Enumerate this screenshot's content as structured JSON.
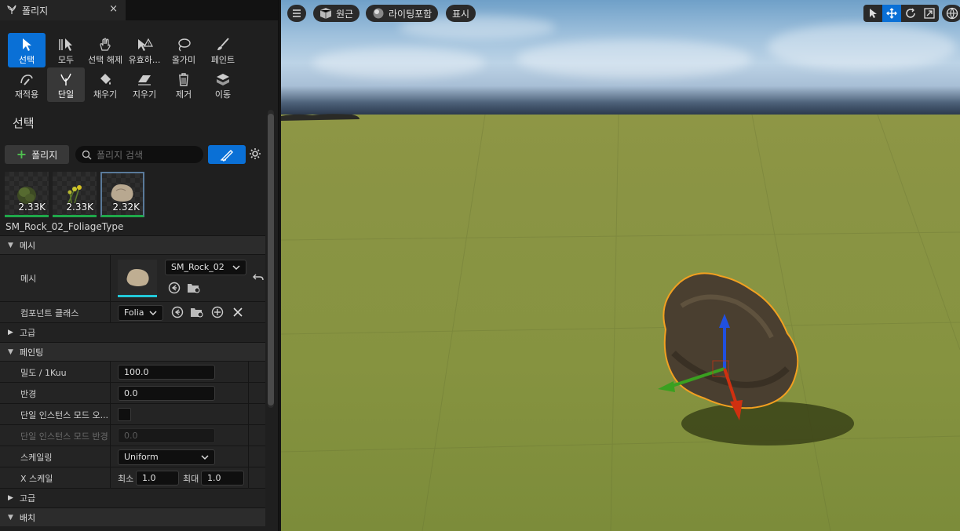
{
  "tab": {
    "title": "폴리지",
    "close": "×"
  },
  "tools": [
    {
      "name": "select",
      "label": "선택",
      "active": true
    },
    {
      "name": "all",
      "label": "모두"
    },
    {
      "name": "deselect",
      "label": "선택 해제"
    },
    {
      "name": "invalid",
      "label": "유효하..."
    },
    {
      "name": "lasso",
      "label": "올가미"
    },
    {
      "name": "paint",
      "label": "페인트"
    },
    {
      "name": "reapply",
      "label": "재적용"
    },
    {
      "name": "single",
      "label": "단일",
      "selected": true
    },
    {
      "name": "fill",
      "label": "채우기"
    },
    {
      "name": "erase",
      "label": "지우기"
    },
    {
      "name": "remove",
      "label": "제거"
    },
    {
      "name": "move",
      "label": "이동"
    }
  ],
  "section_title": "선택",
  "toolbar": {
    "add_label": "폴리지",
    "search_placeholder": "폴리지 검색"
  },
  "thumbs": [
    {
      "count": "2.33K"
    },
    {
      "count": "2.33K"
    },
    {
      "count": "2.32K",
      "selected": true
    }
  ],
  "asset_name": "SM_Rock_02_FoliageType",
  "details": {
    "cat_mesh": "메시",
    "mesh_label": "메시",
    "mesh_value": "SM_Rock_02",
    "component_label": "컴포넌트 클래스",
    "component_value": "Folia",
    "advanced1": "고급",
    "cat_painting": "페인팅",
    "density_label": "밀도 / 1Kuu",
    "density_value": "100.0",
    "radius_label": "반경",
    "radius_value": "0.0",
    "single_override_label": "단일 인스턴스 모드 오...",
    "single_radius_label": "단일 인스턴스 모드 반경",
    "single_radius_value": "0.0",
    "scaling_label": "스케일링",
    "scaling_value": "Uniform",
    "xscale_label": "X 스케일",
    "min_label": "최소",
    "min_value": "1.0",
    "max_label": "최대",
    "max_value": "1.0",
    "advanced2": "고급",
    "cat_placement": "배치"
  },
  "viewport": {
    "perspective": "원근",
    "lighting": "라이팅포함",
    "show": "표시"
  }
}
